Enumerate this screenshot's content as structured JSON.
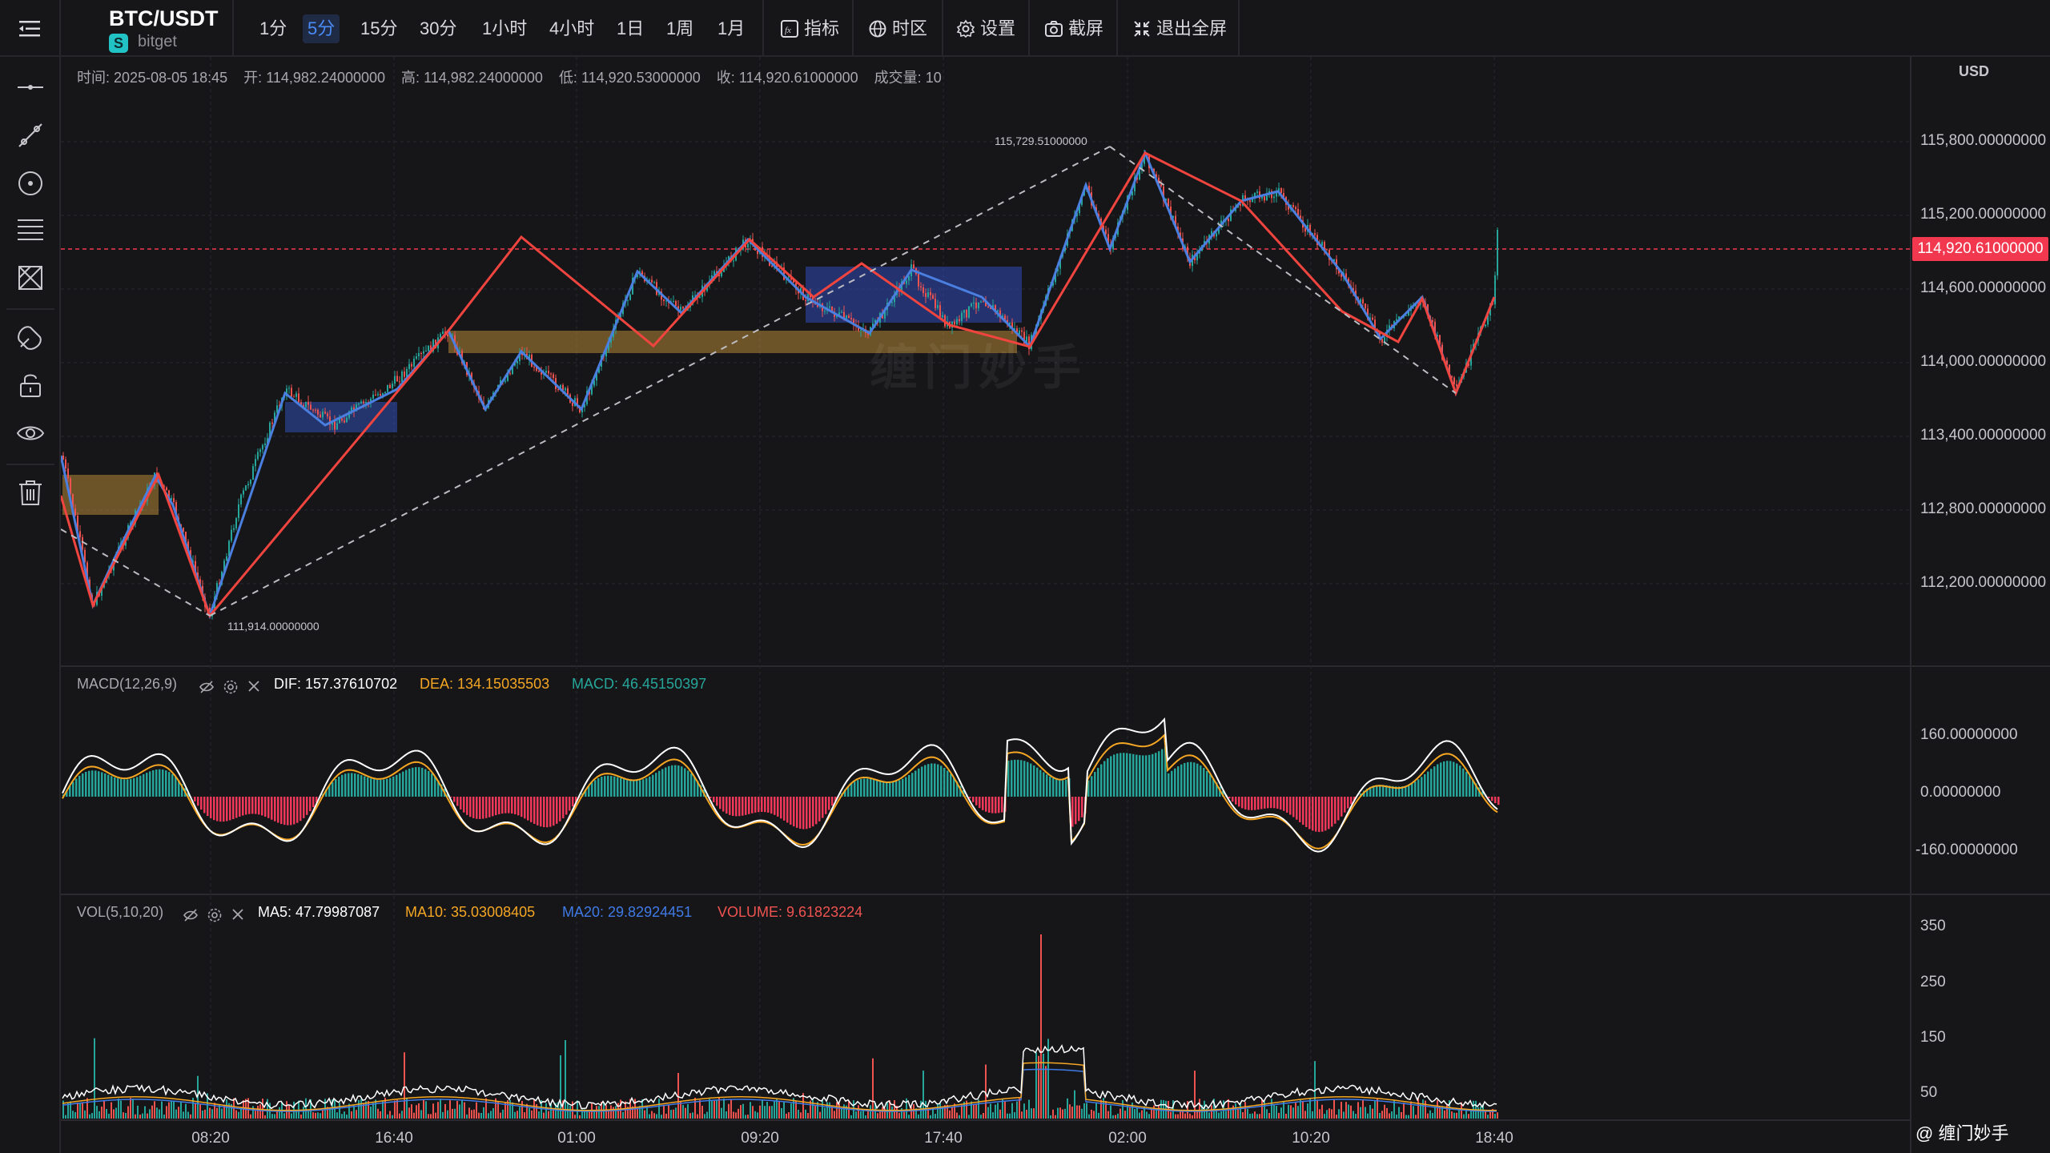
{
  "header": {
    "symbol": "BTC/USDT",
    "exchange": "bitget",
    "intervals": [
      "1分",
      "5分",
      "15分",
      "30分",
      "1小时",
      "4小时",
      "1日",
      "1周",
      "1月"
    ],
    "active_interval": "5分",
    "tools": {
      "indicators": "指标",
      "timezone": "时区",
      "settings": "设置",
      "screenshot": "截屏",
      "exit_fullscreen": "退出全屏"
    }
  },
  "left_toolbar": {
    "icons": [
      "horizontal-line-icon",
      "trend-line-icon",
      "circle-icon",
      "fibonacci-icon",
      "pattern-icon",
      "magnet-icon",
      "lock-icon",
      "eye-icon",
      "trash-icon"
    ]
  },
  "ohlc": {
    "time_label": "时间:",
    "time": "2025-08-05 18:45",
    "open_label": "开:",
    "open": "114,982.24000000",
    "high_label": "高:",
    "high": "114,982.24000000",
    "low_label": "低:",
    "low": "114,920.53000000",
    "close_label": "收:",
    "close": "114,920.61000000",
    "volume_label": "成交量:",
    "volume": "10"
  },
  "price_axis": {
    "currency": "USD",
    "labels": [
      "115,800.00000000",
      "115,200.00000000",
      "114,600.00000000",
      "114,000.00000000",
      "113,400.00000000",
      "112,800.00000000",
      "112,200.00000000"
    ],
    "current_price": "114,920.61000000"
  },
  "annotations": {
    "high_mark": "115,729.51000000",
    "low_mark": "111,914.00000000",
    "watermark": "缠门妙手"
  },
  "macd": {
    "title": "MACD(12,26,9)",
    "dif": "DIF: 157.37610702",
    "dea": "DEA: 134.15035503",
    "macd": "MACD: 46.45150397",
    "axis": [
      "160.00000000",
      "0.00000000",
      "-160.00000000"
    ]
  },
  "vol": {
    "title": "VOL(5,10,20)",
    "ma5": "MA5: 47.79987087",
    "ma10": "MA10: 35.03008405",
    "ma20": "MA20: 29.82924451",
    "volume": "VOLUME: 9.61823224",
    "axis": [
      "350",
      "250",
      "150",
      "50"
    ]
  },
  "time_axis": [
    "08:20",
    "16:40",
    "01:00",
    "09:20",
    "17:40",
    "02:00",
    "10:20",
    "18:40"
  ],
  "brand": "@ 缠门妙手",
  "colors": {
    "up": "#26a69a",
    "down": "#ef5350",
    "stroke_red": "#f0443f",
    "stroke_blue": "#4a7fe0",
    "dif": "#ffffff",
    "dea": "#f5a623",
    "ma20": "#3f7ae6",
    "price_tag": "#f2384f"
  }
}
